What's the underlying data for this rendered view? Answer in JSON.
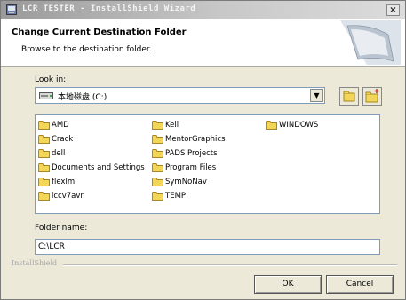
{
  "window": {
    "title": "LCR_TESTER - InstallShield Wizard",
    "close_label": "×"
  },
  "header": {
    "title": "Change Current Destination Folder",
    "subtitle": "Browse to the destination folder."
  },
  "look_in": {
    "label": "Look in:",
    "value": "本地磁盘 (C:)",
    "dropdown_icon": "▼"
  },
  "folders": [
    {
      "name": "AMD"
    },
    {
      "name": "Crack"
    },
    {
      "name": "dell"
    },
    {
      "name": "Documents and Settings"
    },
    {
      "name": "flexlm"
    },
    {
      "name": "iccv7avr"
    },
    {
      "name": "Keil"
    },
    {
      "name": "MentorGraphics"
    },
    {
      "name": "PADS Projects"
    },
    {
      "name": "Program Files"
    },
    {
      "name": "SymNoNav"
    },
    {
      "name": "TEMP"
    },
    {
      "name": "WINDOWS"
    }
  ],
  "folder_name": {
    "label": "Folder name:",
    "value": "C:\\LCR"
  },
  "footer": {
    "brand": "InstallShield",
    "ok_label": "OK",
    "cancel_label": "Cancel"
  },
  "colors": {
    "folder_yellow": "#f2d65a",
    "folder_outline": "#a8871e",
    "dialog_bg": "#ece9d8",
    "field_border": "#7f9db9"
  },
  "icons": {
    "title": "installer-icon",
    "drive": "drive-icon",
    "up_folder": "up-one-level-icon",
    "new_folder": "new-folder-icon",
    "folder": "folder-icon"
  }
}
